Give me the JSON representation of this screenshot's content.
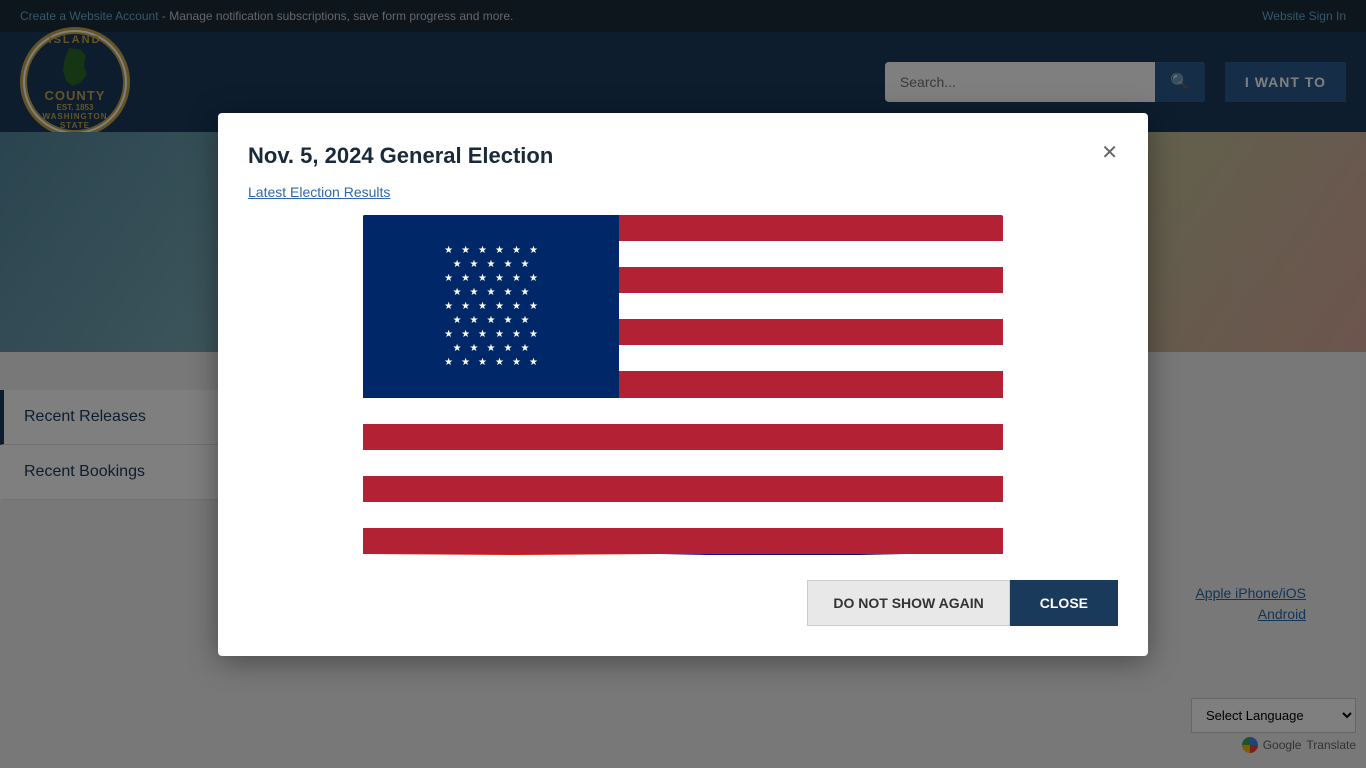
{
  "topbar": {
    "account_text": "Create a Website Account",
    "account_description": " - Manage notification subscriptions, save form progress and more.",
    "sign_in_label": "Website Sign In"
  },
  "header": {
    "logo": {
      "island_text": "ISLAND",
      "county_text": "COUNTY",
      "state_text": "WASHINGTON STATE",
      "est_text": "EST. 1853"
    },
    "search": {
      "placeholder": "Search..."
    },
    "i_want_to": "I WANT TO"
  },
  "sidebar": {
    "items": [
      {
        "id": "recent-releases",
        "label": "Recent Releases"
      },
      {
        "id": "recent-bookings",
        "label": "Recent Bookings"
      }
    ]
  },
  "modal": {
    "title": "Nov. 5, 2024 General Election",
    "link_text": "Latest Election Results",
    "close_x": "✕",
    "btn_do_not_show": "DO NOT SHOW AGAIN",
    "btn_close": "CLOSE"
  },
  "bottom_links": {
    "apple": "Apple iPhone/iOS",
    "android": "Android"
  },
  "translate": {
    "label": "Select Language",
    "google_text": "Google",
    "translate_text": "Translate"
  }
}
